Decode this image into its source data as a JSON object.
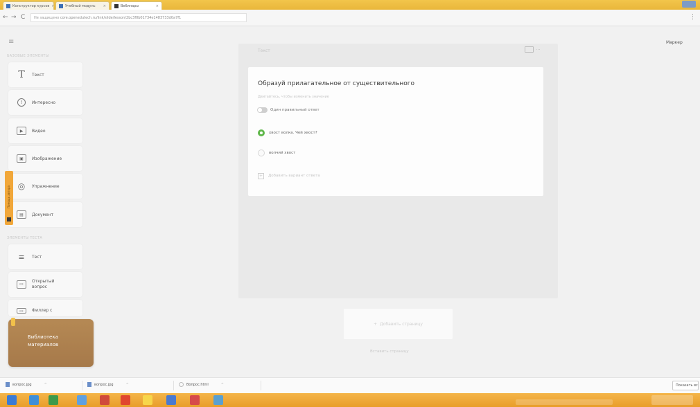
{
  "browser": {
    "tabs": [
      {
        "title": "Конструктор курсов"
      },
      {
        "title": "Учебный модуль"
      },
      {
        "title": "Вебинары"
      }
    ],
    "nav_back": "←",
    "nav_forward": "→",
    "nav_reload": "C",
    "address_protocol": "Не защищено",
    "address_url": "core.openedutech.ru/link/slide/lesson/2bc3f0b01734e1483733d0a7f1",
    "menu": "⋮"
  },
  "sidebar": {
    "menu_icon": "≡",
    "section_basic": "БАЗОВЫЕ ЭЛЕМЕНТЫ",
    "basic_items": [
      {
        "label": "Текст",
        "icon": "T"
      },
      {
        "label": "Интересно",
        "icon": "!"
      },
      {
        "label": "Видео",
        "icon": "▶"
      },
      {
        "label": "Изображение",
        "icon": "▣"
      },
      {
        "label": "Упражнение",
        "icon": "◎"
      },
      {
        "label": "Документ",
        "icon": "▤"
      }
    ],
    "section_tests": "ЭЛЕМЕНТЫ ТЕСТА",
    "test_items": [
      {
        "label": "Тест",
        "icon": "≡"
      },
      {
        "label": "Открытый вопрос",
        "icon": "▭"
      },
      {
        "label": "Филлер с",
        "icon": "▭"
      }
    ],
    "side_tab_text": "Помощь автора",
    "library_label": "Библиотека материалов"
  },
  "editor": {
    "block_label": "Текст",
    "question_title": "Образуй прилагательное от существительного",
    "question_hint": "Двигайтесь, чтобы изменить значение",
    "toggle_label": "Один правильный ответ",
    "options": [
      {
        "text": "хвост волка. Чей хвост?",
        "selected": true
      },
      {
        "text": "волчий хвост",
        "selected": false
      }
    ],
    "add_option_icon": "+",
    "add_option_label": "Добавить вариант ответа",
    "add_page_icon": "+",
    "add_page_label": "Добавить страницу",
    "paste_page_label": "Вставить страницу",
    "right_label": "Маркер"
  },
  "downloads": {
    "items": [
      {
        "name": "вопрос.jpg"
      },
      {
        "name": "вопрос.jpg"
      },
      {
        "name": "Вопрос.html"
      }
    ],
    "show_all": "Показать все"
  },
  "colors": {
    "accent_orange": "#f1a73a",
    "selected_green": "#5fb74a",
    "library_brown": "#a97c4c",
    "taskbar": "#e89d2a"
  }
}
